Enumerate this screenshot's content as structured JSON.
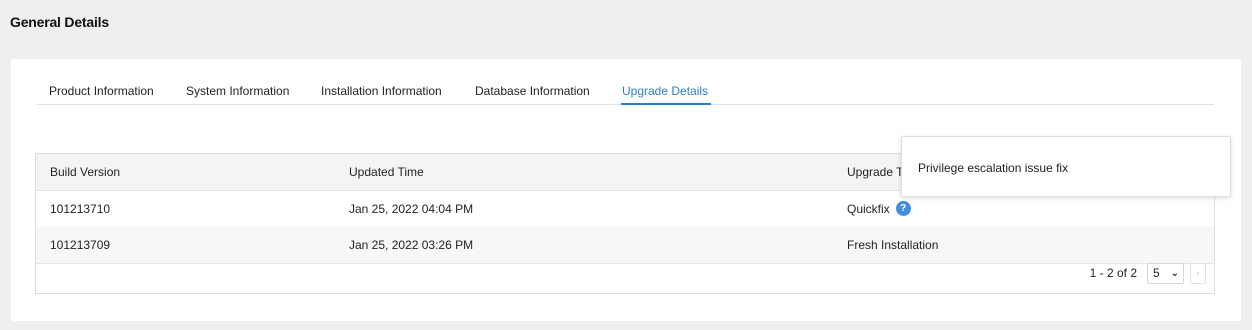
{
  "page": {
    "title": "General Details"
  },
  "tabs": [
    {
      "label": "Product Information"
    },
    {
      "label": "System Information"
    },
    {
      "label": "Installation Information"
    },
    {
      "label": "Database Information"
    },
    {
      "label": "Upgrade Details",
      "active": true
    }
  ],
  "table": {
    "columns": [
      "Build Version",
      "Updated Time",
      "Upgrade Type"
    ],
    "visible_header_third": "Upgrade T",
    "rows": [
      {
        "build_version": "101213710",
        "updated_time": "Jan 25, 2022 04:04 PM",
        "upgrade_type": "Quickfix",
        "has_help": true
      },
      {
        "build_version": "101213709",
        "updated_time": "Jan 25, 2022 03:26 PM",
        "upgrade_type": "Fresh Installation",
        "has_help": false
      }
    ]
  },
  "pagination": {
    "range_text": "1 - 2 of 2",
    "page_size": "5",
    "prev_icon": "chevron-left-icon",
    "next_icon": "chevron-right-icon"
  },
  "tooltip": {
    "text": "Privilege escalation issue fix"
  },
  "icons": {
    "help": "?",
    "chevron_down": "⌄"
  },
  "colors": {
    "accent": "#2a7fc9",
    "help_icon": "#3f8fe0",
    "background": "#efefef"
  }
}
